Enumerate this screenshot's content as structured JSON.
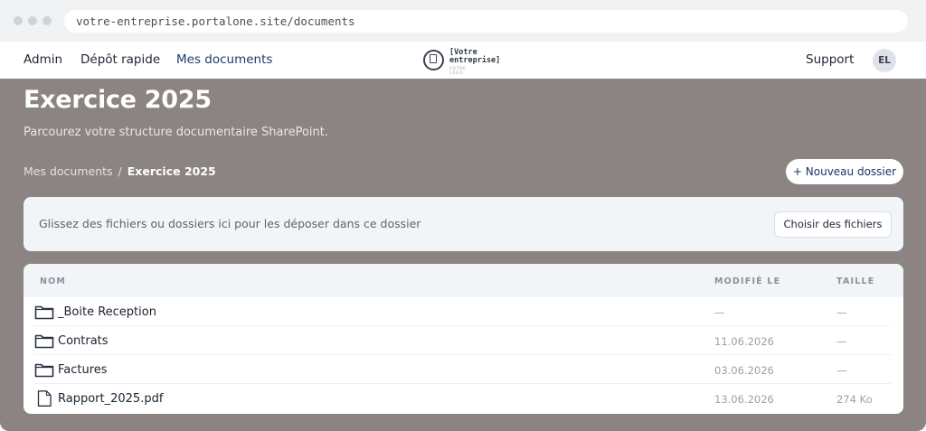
{
  "browser": {
    "url": "votre-entreprise.portalone.site/documents"
  },
  "nav": {
    "admin": "Admin",
    "depot": "Dépôt rapide",
    "docs": "Mes documents",
    "support": "Support",
    "avatar_initials": "EL",
    "active_color": "#1d3a6b"
  },
  "logo": {
    "line1": "[Votre",
    "line2": "entreprise]",
    "tagline": "VOTRE LOGO"
  },
  "page": {
    "title": "Exercice 2025",
    "subtitle": "Parcourez votre structure documentaire SharePoint.",
    "background": "#8c8483"
  },
  "breadcrumb": {
    "parent": "Mes documents",
    "separator": "/",
    "current": "Exercice 2025"
  },
  "actions": {
    "new_folder": "+ Nouveau dossier"
  },
  "dropzone": {
    "text": "Glissez des fichiers ou dossiers ici pour les déposer dans ce dossier",
    "button": "Choisir des fichiers"
  },
  "table": {
    "columns": {
      "name": "NOM",
      "modified": "MODIFIÉ LE",
      "size": "TAILLE"
    },
    "rows": [
      {
        "icon": "folder-icon",
        "name": "_Boite Reception",
        "modified": "—",
        "size": "—"
      },
      {
        "icon": "folder-icon",
        "name": "Contrats",
        "modified": "11.06.2026",
        "size": "—"
      },
      {
        "icon": "folder-icon",
        "name": "Factures",
        "modified": "03.06.2026",
        "size": "—"
      },
      {
        "icon": "file-icon",
        "name": "Rapport_2025.pdf",
        "modified": "13.06.2026",
        "size": "274 Ko"
      }
    ]
  }
}
